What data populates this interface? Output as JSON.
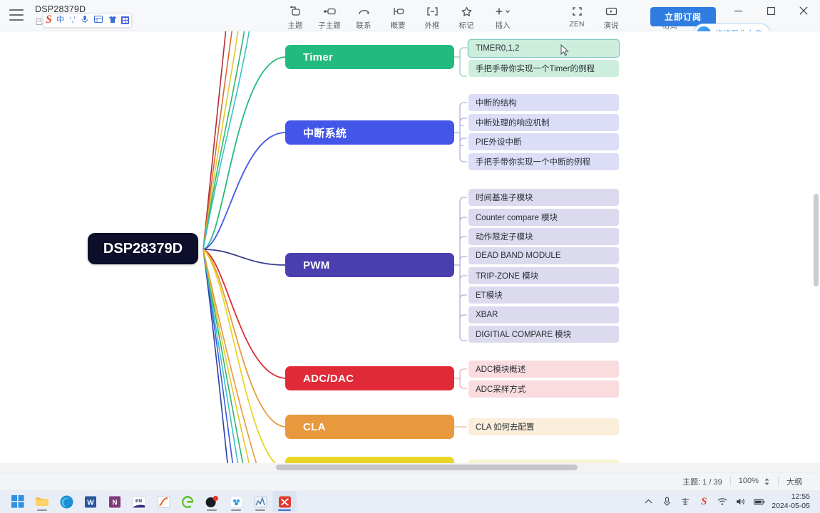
{
  "titlebar": {
    "menu_icon": "hamburger-icon",
    "doc_title": "DSP28379D",
    "doc_status": "已编辑",
    "subscribe_label": "立即订阅",
    "upload_label": "拖拽至此上传",
    "upload_icon": "cloud-upload-icon",
    "window_controls": {
      "minimize": "minimize-icon",
      "maximize": "maximize-icon",
      "close": "close-icon"
    }
  },
  "ime": {
    "logo": "S",
    "items": [
      "中",
      "‘,’",
      "mic-icon",
      "keyboard-icon",
      "skin-icon",
      "toolbox-icon"
    ]
  },
  "toolbar": {
    "groups": [
      {
        "items": [
          {
            "label": "主题",
            "icon": "topic-icon"
          },
          {
            "label": "子主题",
            "icon": "subtopic-icon"
          },
          {
            "label": "联系",
            "icon": "relationship-icon"
          },
          {
            "label": "概要",
            "icon": "summary-icon"
          },
          {
            "label": "外框",
            "icon": "boundary-icon"
          },
          {
            "label": "标记",
            "icon": "marker-star-icon"
          },
          {
            "label": "插入",
            "icon": "insert-plus-icon",
            "has_caret": true
          }
        ]
      },
      {
        "items": [
          {
            "label": "ZEN",
            "icon": "zen-fullscreen-icon"
          },
          {
            "label": "演说",
            "icon": "presentation-icon"
          }
        ]
      },
      {
        "items": [
          {
            "label": "格式",
            "icon": "format-panel-icon"
          }
        ]
      }
    ]
  },
  "mindmap": {
    "root": {
      "label": "DSP28379D",
      "color": "#0d0f2b"
    },
    "branches": [
      {
        "label": "Timer",
        "color": "#22bb7f",
        "child_bg": "#cdeedd",
        "children": [
          {
            "label": "TIMER0,1,2",
            "selected": true
          },
          {
            "label": "手把手带你实现一个Timer的例程",
            "selected": false
          }
        ]
      },
      {
        "label": "中断系统",
        "color": "#4356e8",
        "child_bg": "#dcdef8",
        "children": [
          {
            "label": "中断的结构",
            "selected": false
          },
          {
            "label": "中断处理的响应机制",
            "selected": false
          },
          {
            "label": "PIE外设中断",
            "selected": false
          },
          {
            "label": "手把手带你实现一个中断的例程",
            "selected": false
          }
        ]
      },
      {
        "label": "PWM",
        "color": "#4b3fb0",
        "child_bg": "#dcdaee",
        "children": [
          {
            "label": "时间基准子模块",
            "selected": false
          },
          {
            "label": "Counter compare 模块",
            "selected": false
          },
          {
            "label": "动作限定子模块",
            "selected": false
          },
          {
            "label": "DEAD BAND MODULE",
            "selected": false
          },
          {
            "label": "TRIP-ZONE 模块",
            "selected": false
          },
          {
            "label": "ET模块",
            "selected": false
          },
          {
            "label": "XBAR",
            "selected": false
          },
          {
            "label": "DIGITIAL COMPARE 模块",
            "selected": false
          }
        ]
      },
      {
        "label": "ADC/DAC",
        "color": "#e02a38",
        "child_bg": "#fadcdf",
        "children": [
          {
            "label": "ADC模块概述",
            "selected": false
          },
          {
            "label": "ADC采样方式",
            "selected": false
          }
        ]
      },
      {
        "label": "CLA",
        "color": "#e8993d",
        "child_bg": "#fbeedb",
        "children": [
          {
            "label": "CLA 如何去配置",
            "selected": false
          }
        ]
      },
      {
        "label": "",
        "color": "#e8d627",
        "child_bg": "#f7f3d2",
        "children": [
          {
            "label": "",
            "selected": false
          }
        ]
      }
    ]
  },
  "statusbar": {
    "topic_count": "主题: 1 / 39",
    "zoom": "100%",
    "outline_label": "大纲"
  },
  "taskbar": {
    "items": [
      {
        "name": "start-button",
        "icon": "windows-logo-icon",
        "active": false,
        "running": false
      },
      {
        "name": "file-explorer",
        "icon": "folder-icon",
        "active": false,
        "running": true
      },
      {
        "name": "edge-browser",
        "icon": "edge-icon",
        "active": false,
        "running": false
      },
      {
        "name": "word",
        "icon": "word-icon",
        "active": false,
        "running": false
      },
      {
        "name": "onenote",
        "icon": "onenote-icon",
        "active": false,
        "running": false
      },
      {
        "name": "endnote",
        "icon": "endnote-icon",
        "active": false,
        "running": false
      },
      {
        "name": "origin",
        "icon": "origin-curve-icon",
        "active": false,
        "running": false
      },
      {
        "name": "browser-360",
        "icon": "green-browser-icon",
        "active": false,
        "running": false
      },
      {
        "name": "zhihu",
        "icon": "black-dot-icon",
        "active": false,
        "running": true
      },
      {
        "name": "baidu-netdisk",
        "icon": "cloud-disk-icon",
        "active": false,
        "running": true
      },
      {
        "name": "matlab",
        "icon": "chart-app-icon",
        "active": false,
        "running": true
      },
      {
        "name": "xmind",
        "icon": "xmind-icon",
        "active": true,
        "running": true
      }
    ],
    "tray": [
      {
        "name": "show-hidden-icons",
        "icon": "chevron-up-icon"
      },
      {
        "name": "microphone",
        "icon": "mic-icon"
      },
      {
        "name": "input-method",
        "icon": "ime-icon"
      },
      {
        "name": "sogou-ime",
        "icon": "sogou-s-icon"
      },
      {
        "name": "network",
        "icon": "wifi-icon"
      },
      {
        "name": "volume",
        "icon": "speaker-icon"
      },
      {
        "name": "battery",
        "icon": "battery-icon"
      }
    ],
    "clock_time": "12:55",
    "clock_date": "2024-05-05"
  }
}
